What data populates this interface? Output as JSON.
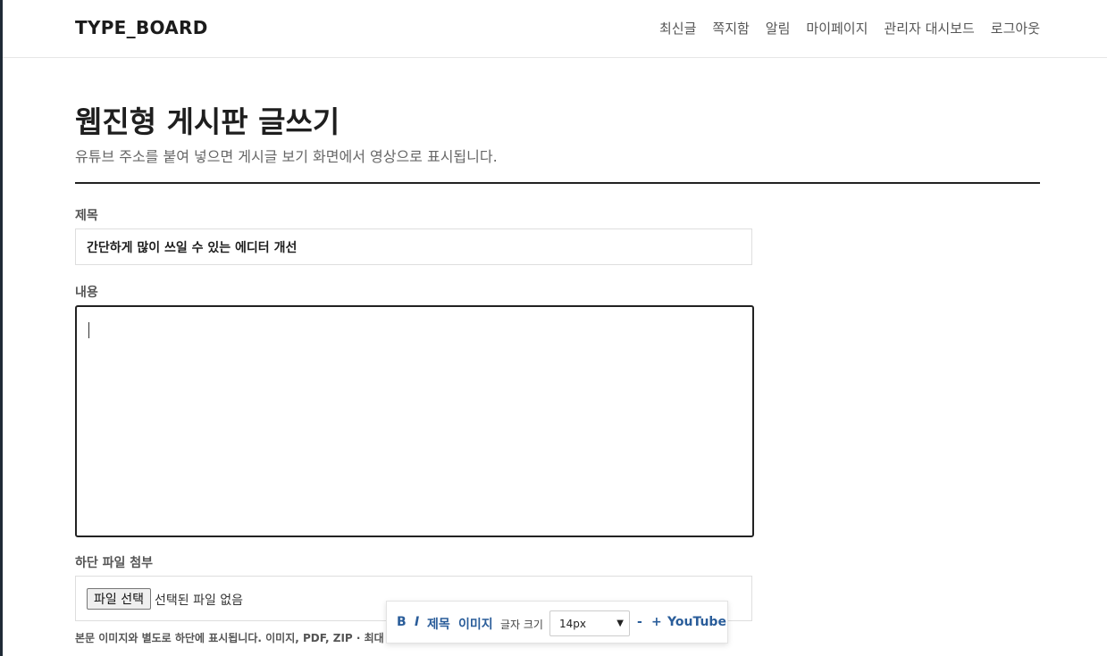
{
  "header": {
    "logo": "TYPE_BOARD",
    "nav": [
      "최신글",
      "쪽지함",
      "알림",
      "마이페이지",
      "관리자 대시보드",
      "로그아웃"
    ]
  },
  "page": {
    "title": "웹진형 게시판 글쓰기",
    "description": "유튜브 주소를 붙여 넣으면 게시글 보기 화면에서 영상으로 표시됩니다."
  },
  "form": {
    "title_label": "제목",
    "title_value": "간단하게 많이 쓰일 수 있는 에디터 개선",
    "content_label": "내용",
    "attach_label": "하단 파일 첨부",
    "file_button": "파일 선택",
    "file_status": "선택된 파일 없음",
    "help_text": "본문 이미지와 별도로 하단에 표시됩니다. 이미지, PDF, ZIP · 최대 10MB"
  },
  "toolbar": {
    "bold": "B",
    "italic": "I",
    "heading": "제목",
    "image": "이미지",
    "font_size_label": "글자 크기",
    "font_size_value": "14px",
    "decrease": "-",
    "increase": "+",
    "youtube": "YouTube"
  },
  "colors": {
    "accent": "#2a5d9a",
    "border_dark": "#222222"
  },
  "icons": {
    "select": "chevron-down-icon"
  }
}
